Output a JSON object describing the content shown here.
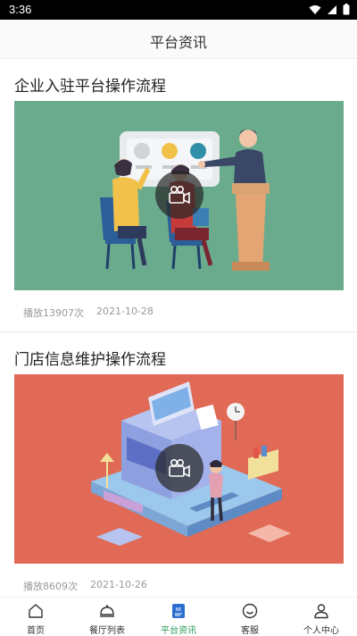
{
  "status_bar": {
    "time": "3:36"
  },
  "header": {
    "title": "平台资讯"
  },
  "articles": [
    {
      "title": "企业入驻平台操作流程",
      "plays": "播放13907次",
      "date": "2021-10-28",
      "thumb_color": "#6aab8e"
    },
    {
      "title": "门店信息维护操作流程",
      "plays": "播放8609次",
      "date": "2021-10-26",
      "thumb_color": "#e06a55"
    }
  ],
  "tabs": [
    {
      "label": "首页",
      "icon": "home-icon"
    },
    {
      "label": "餐厅列表",
      "icon": "restaurant-bell-icon"
    },
    {
      "label": "平台资讯",
      "icon": "news-icon",
      "active": true
    },
    {
      "label": "客服",
      "icon": "customer-service-icon"
    },
    {
      "label": "个人中心",
      "icon": "person-icon"
    }
  ],
  "colors": {
    "accent": "#2a9c5a",
    "article1_bg": "#6aab8e",
    "article2_bg": "#e06a55"
  }
}
